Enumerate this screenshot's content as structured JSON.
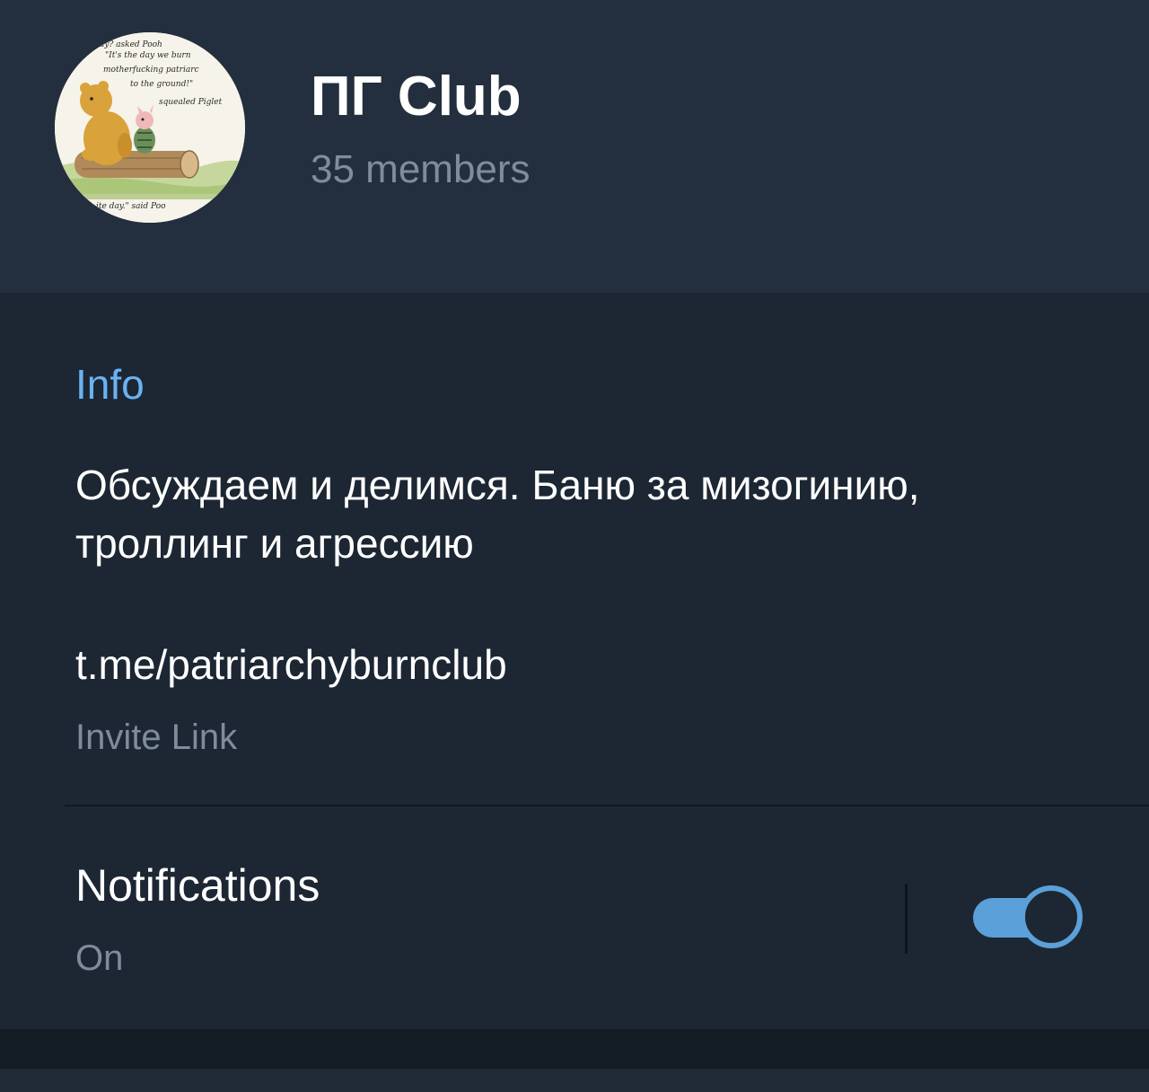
{
  "header": {
    "title": "ПГ Club",
    "members": "35 members",
    "avatar": {
      "text_lines": [
        "ay? asked Pooh",
        "\"It's the day we burn",
        "motherfucking patriarc",
        "to the ground!\"",
        "squealed Piglet",
        "ite day.\" said Poo"
      ]
    }
  },
  "info": {
    "section_title": "Info",
    "description": "Обсуждаем и делимся. Баню за мизогинию, троллинг и агрессию",
    "invite_link": "t.me/patriarchyburnclub",
    "invite_caption": "Invite Link"
  },
  "notifications": {
    "label": "Notifications",
    "status": "On",
    "enabled": true
  },
  "colors": {
    "header_bg": "#232f3e",
    "panel_bg": "#1d2733",
    "accent": "#6ab3f3",
    "toggle": "#5ba0d8",
    "secondary_text": "#7e8c9b"
  }
}
